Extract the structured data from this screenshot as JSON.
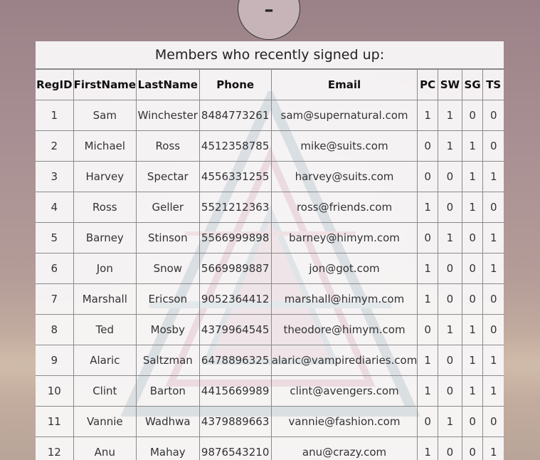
{
  "top_button": {
    "label": "–"
  },
  "table": {
    "title": "Members who recently signed up:",
    "columns": [
      "RegID",
      "FirstName",
      "LastName",
      "Phone",
      "Email",
      "PC",
      "SW",
      "SG",
      "TS"
    ],
    "rows": [
      [
        "1",
        "Sam",
        "Winchester",
        "8484773261",
        "sam@supernatural.com",
        "1",
        "1",
        "0",
        "0"
      ],
      [
        "2",
        "Michael",
        "Ross",
        "4512358785",
        "mike@suits.com",
        "0",
        "1",
        "1",
        "0"
      ],
      [
        "3",
        "Harvey",
        "Spectar",
        "4556331255",
        "harvey@suits.com",
        "0",
        "0",
        "1",
        "1"
      ],
      [
        "4",
        "Ross",
        "Geller",
        "5521212363",
        "ross@friends.com",
        "1",
        "0",
        "1",
        "0"
      ],
      [
        "5",
        "Barney",
        "Stinson",
        "5566999898",
        "barney@himym.com",
        "0",
        "1",
        "0",
        "1"
      ],
      [
        "6",
        "Jon",
        "Snow",
        "5669989887",
        "jon@got.com",
        "1",
        "0",
        "0",
        "1"
      ],
      [
        "7",
        "Marshall",
        "Ericson",
        "9052364412",
        "marshall@himym.com",
        "1",
        "0",
        "0",
        "0"
      ],
      [
        "8",
        "Ted",
        "Mosby",
        "4379964545",
        "theodore@himym.com",
        "0",
        "1",
        "1",
        "0"
      ],
      [
        "9",
        "Alaric",
        "Saltzman",
        "6478896325",
        "alaric@vampirediaries.com",
        "1",
        "0",
        "1",
        "1"
      ],
      [
        "10",
        "Clint",
        "Barton",
        "4415669989",
        "clint@avengers.com",
        "1",
        "0",
        "1",
        "1"
      ],
      [
        "11",
        "Vannie",
        "Wadhwa",
        "4379889663",
        "vannie@fashion.com",
        "0",
        "1",
        "0",
        "0"
      ],
      [
        "12",
        "Anu",
        "Mahay",
        "9876543210",
        "anu@crazy.com",
        "1",
        "0",
        "0",
        "1"
      ]
    ]
  }
}
